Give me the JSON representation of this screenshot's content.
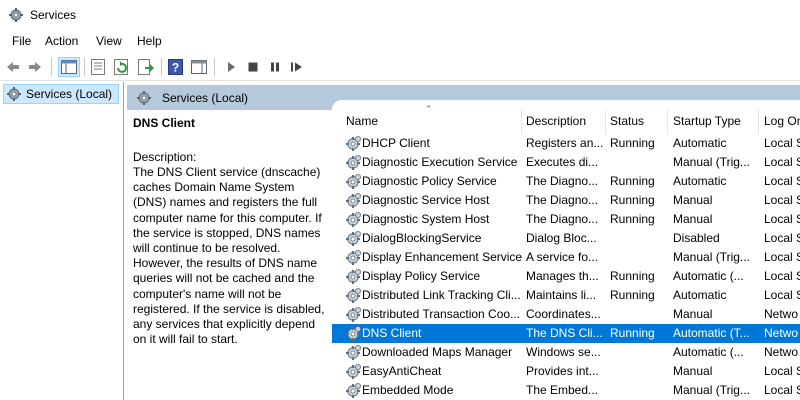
{
  "window": {
    "title": "Services",
    "app_icon": "services-gear-icon"
  },
  "menu": [
    "File",
    "Action",
    "View",
    "Help"
  ],
  "toolbar": {
    "buttons": [
      "back-arrow-icon",
      "forward-arrow-icon",
      "show-hide-console-tree-icon",
      "properties-icon",
      "refresh-icon",
      "export-list-icon",
      "help-icon",
      "action-pane-icon",
      "start-service-icon",
      "stop-service-icon",
      "pause-service-icon",
      "restart-service-icon"
    ]
  },
  "tree": {
    "item_label": "Services (Local)"
  },
  "panel": {
    "title": "Services (Local)"
  },
  "details": {
    "service_name": "DNS Client",
    "description_label": "Description:",
    "description_text": "The DNS Client service (dnscache) caches Domain Name System (DNS) names and registers the full computer name for this computer. If the service is stopped, DNS names will continue to be resolved. However, the results of DNS name queries will not be cached and the computer's name will not be registered. If the service is disabled, any services that explicitly depend on it will fail to start."
  },
  "table": {
    "columns": [
      "Name",
      "Description",
      "Status",
      "Startup Type",
      "Log On"
    ],
    "rows": [
      {
        "name": "DHCP Client",
        "description": "Registers an...",
        "status": "Running",
        "startup": "Automatic",
        "logon": "Local S"
      },
      {
        "name": "Diagnostic Execution Service",
        "description": "Executes di...",
        "status": "",
        "startup": "Manual (Trig...",
        "logon": "Local S"
      },
      {
        "name": "Diagnostic Policy Service",
        "description": "The Diagno...",
        "status": "Running",
        "startup": "Automatic",
        "logon": "Local S"
      },
      {
        "name": "Diagnostic Service Host",
        "description": "The Diagno...",
        "status": "Running",
        "startup": "Manual",
        "logon": "Local S"
      },
      {
        "name": "Diagnostic System Host",
        "description": "The Diagno...",
        "status": "Running",
        "startup": "Manual",
        "logon": "Local S"
      },
      {
        "name": "DialogBlockingService",
        "description": "Dialog Bloc...",
        "status": "",
        "startup": "Disabled",
        "logon": "Local S"
      },
      {
        "name": "Display Enhancement Service",
        "description": "A service fo...",
        "status": "",
        "startup": "Manual (Trig...",
        "logon": "Local S"
      },
      {
        "name": "Display Policy Service",
        "description": "Manages th...",
        "status": "Running",
        "startup": "Automatic (...",
        "logon": "Local S"
      },
      {
        "name": "Distributed Link Tracking Cli...",
        "description": "Maintains li...",
        "status": "Running",
        "startup": "Automatic",
        "logon": "Local S"
      },
      {
        "name": "Distributed Transaction Coo...",
        "description": "Coordinates...",
        "status": "",
        "startup": "Manual",
        "logon": "Netwo"
      },
      {
        "name": "DNS Client",
        "description": "The DNS Cli...",
        "status": "Running",
        "startup": "Automatic (T...",
        "logon": "Netwo",
        "selected": true
      },
      {
        "name": "Downloaded Maps Manager",
        "description": "Windows se...",
        "status": "",
        "startup": "Automatic (...",
        "logon": "Netwo"
      },
      {
        "name": "EasyAntiCheat",
        "description": "Provides int...",
        "status": "",
        "startup": "Manual",
        "logon": "Local S"
      },
      {
        "name": "Embedded Mode",
        "description": "The Embed...",
        "status": "",
        "startup": "Manual (Trig...",
        "logon": "Local S"
      }
    ]
  },
  "colors": {
    "selection": "#0078d7",
    "panel_header": "#b6c9dc",
    "tree_selection": "#cce8ff"
  }
}
